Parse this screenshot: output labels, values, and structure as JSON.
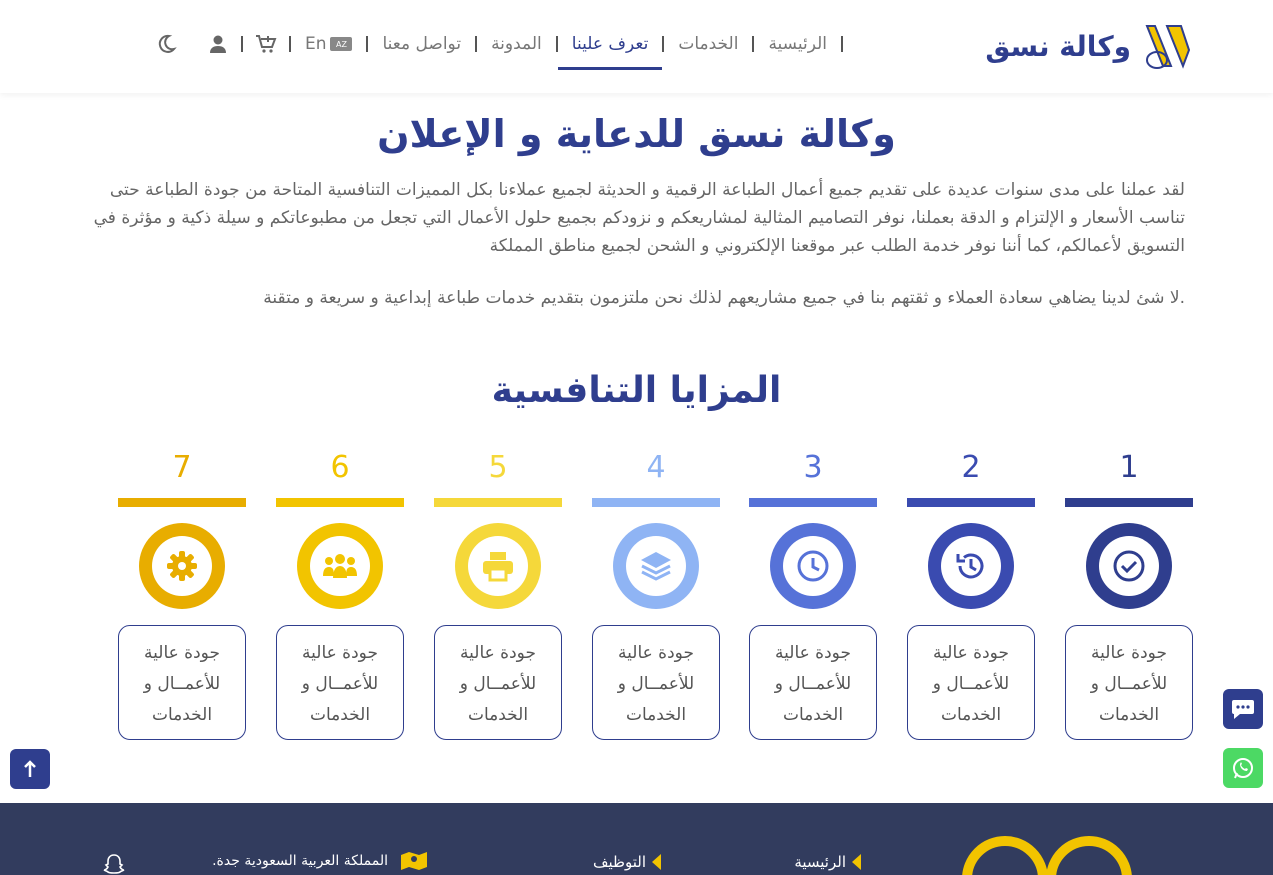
{
  "brand": {
    "name": "وكالة نسق",
    "colors": {
      "primary": "#2f3e8e",
      "accent": "#f2c400"
    }
  },
  "nav": {
    "items": [
      {
        "label": "الرئيسية",
        "active": false
      },
      {
        "label": "الخدمات",
        "active": false
      },
      {
        "label": "تعرف علينا",
        "active": true
      },
      {
        "label": "المدونة",
        "active": false
      },
      {
        "label": "تواصل معنا",
        "active": false
      }
    ],
    "lang_label": "En",
    "lang_badge": "AZ",
    "icons": [
      "cart-plus-icon",
      "user-icon",
      "moon-icon"
    ]
  },
  "intro": {
    "title": "وكالة نسق للدعاية و الإعلان",
    "paragraph1": "لقد عملنا على مدى سنوات عديدة على تقديم جميع أعمال الطباعة الرقمية و الحديثة لجميع عملاءنا بكل المميزات التنافسية المتاحة من جودة الطباعة حتى تناسب الأسعار و الإلتزام و الدقة بعملنا، نوفر التصاميم المثالية لمشاريعكم و نزودكم بجميع حلول الأعمال التي تجعل من مطبوعاتكم و سيلة ذكية و مؤثرة في التسويق لأعمالكم، كما أننا نوفر خدمة الطلب عبر موقعنا الإلكتروني و الشحن لجميع مناطق المملكة",
    "paragraph2": ".لا شئ لدينا يضاهي سعادة العملاء و ثقتهم بنا في جميع مشاريعهم لذلك نحن ملتزمون بتقديم خدمات طباعة إبداعية و سريعة و متقنة"
  },
  "advantages": {
    "title": "المزايا التنافسية",
    "items": [
      {
        "number": "1",
        "text": "جودة عالية للأعمــال و الخدمات",
        "color": "#2f3e8e",
        "icon": "check-circle-icon"
      },
      {
        "number": "2",
        "text": "جودة عالية للأعمــال و الخدمات",
        "color": "#3a4bb0",
        "icon": "history-icon"
      },
      {
        "number": "3",
        "text": "جودة عالية للأعمــال و الخدمات",
        "color": "#5672d8",
        "icon": "clock-icon"
      },
      {
        "number": "4",
        "text": "جودة عالية للأعمــال و الخدمات",
        "color": "#8fb4f4",
        "icon": "layers-icon"
      },
      {
        "number": "5",
        "text": "جودة عالية للأعمــال و الخدمات",
        "color": "#f5d83a",
        "icon": "printer-icon"
      },
      {
        "number": "6",
        "text": "جودة عالية للأعمــال و الخدمات",
        "color": "#f2c400",
        "icon": "users-icon"
      },
      {
        "number": "7",
        "text": "جودة عالية للأعمــال و الخدمات",
        "color": "#e8ad00",
        "icon": "gear-icon"
      }
    ]
  },
  "footer": {
    "links": [
      "الرئيسية",
      "التوظيف"
    ],
    "address": "المملكة العربية السعودية جدة."
  }
}
